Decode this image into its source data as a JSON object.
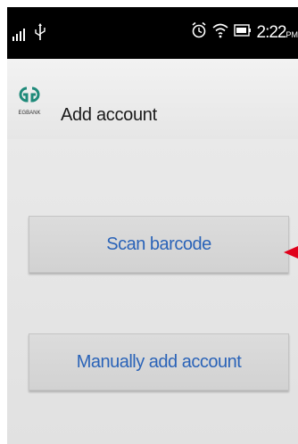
{
  "status_bar": {
    "time": "2:22",
    "time_suffix": "PM",
    "icons": [
      "signal-icon",
      "usb-icon",
      "alarm-icon",
      "wifi-icon",
      "battery-icon"
    ]
  },
  "app_bar": {
    "logo_text": "EGBANK",
    "title": "Add account"
  },
  "actions": {
    "scan_label": "Scan barcode",
    "manual_label": "Manually add account"
  },
  "colors": {
    "status_bar": "#000000",
    "button_text": "#2a63b8",
    "logo": "#1f8a7a",
    "annotation_arrow": "#e0001b"
  }
}
